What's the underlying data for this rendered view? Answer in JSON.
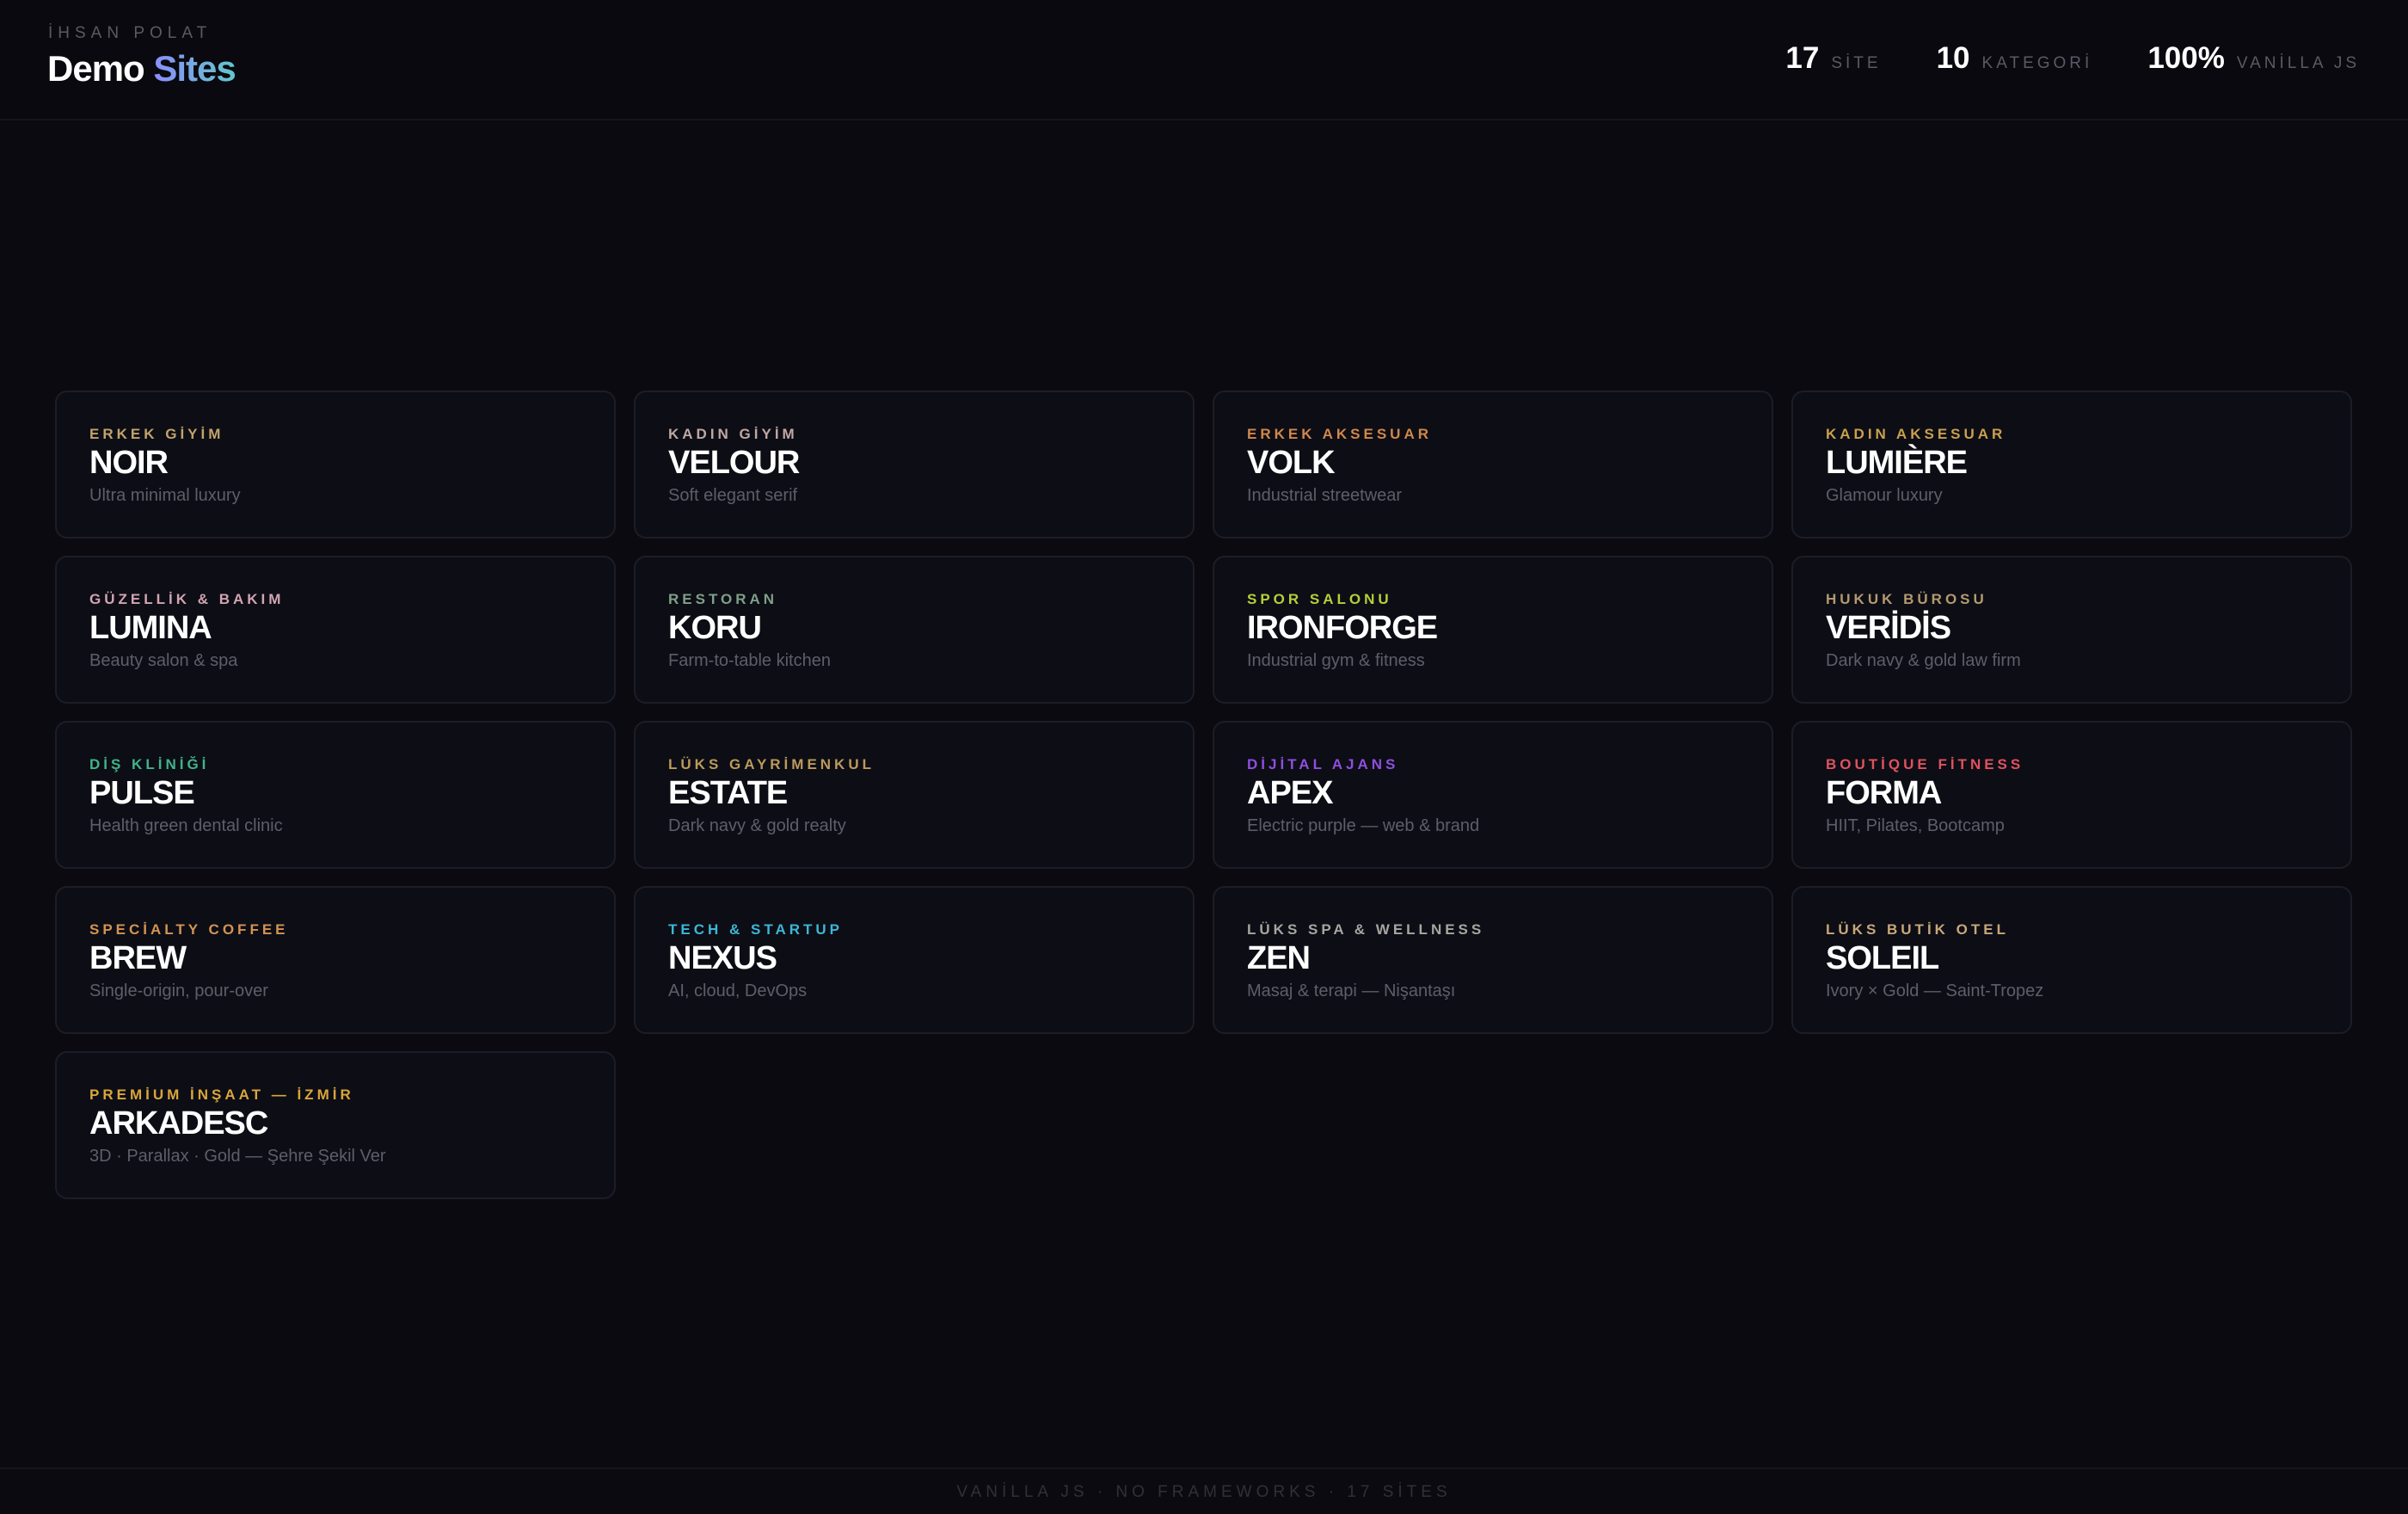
{
  "header": {
    "eyebrow": "İHSAN POLAT",
    "title_part1": "Demo",
    "title_part2": "Sites",
    "title_gradient": [
      "#8b8dfb",
      "#62c7c8"
    ],
    "stats": [
      {
        "value": "17",
        "label": "SİTE"
      },
      {
        "value": "10",
        "label": "KATEGORİ"
      },
      {
        "value": "100%",
        "label": "VANİLLA JS"
      }
    ]
  },
  "sites": [
    {
      "category": "ERKEK GİYİM",
      "name": "NOIR",
      "desc": "Ultra minimal luxury",
      "color": "#c2a36a"
    },
    {
      "category": "KADIN GİYİM",
      "name": "VELOUR",
      "desc": "Soft elegant serif",
      "color": "#bfa8a2"
    },
    {
      "category": "ERKEK AKSESUAR",
      "name": "VOLK",
      "desc": "Industrial streetwear",
      "color": "#d2874a"
    },
    {
      "category": "KADIN AKSESUAR",
      "name": "LUMIÈRE",
      "desc": "Glamour luxury",
      "color": "#c9a04e"
    },
    {
      "category": "GÜZELLİK & BAKIM",
      "name": "LUMINA",
      "desc": "Beauty salon & spa",
      "color": "#d2a4b3"
    },
    {
      "category": "RESTORAN",
      "name": "KORU",
      "desc": "Farm-to-table kitchen",
      "color": "#7fa08a"
    },
    {
      "category": "SPOR SALONU",
      "name": "IRONFORGE",
      "desc": "Industrial gym & fitness",
      "color": "#b7cf3a"
    },
    {
      "category": "HUKUK BÜROSU",
      "name": "VERİDİS",
      "desc": "Dark navy & gold law firm",
      "color": "#b49a6e"
    },
    {
      "category": "DİŞ KLİNİĞİ",
      "name": "PULSE",
      "desc": "Health green dental clinic",
      "color": "#3fb48a"
    },
    {
      "category": "LÜKS GAYRİMENKUL",
      "name": "ESTATE",
      "desc": "Dark navy & gold realty",
      "color": "#bc9a5a"
    },
    {
      "category": "DİJİTAL AJANS",
      "name": "APEX",
      "desc": "Electric purple — web & brand",
      "color": "#8e4fe0"
    },
    {
      "category": "BOUTİQUE FİTNESS",
      "name": "FORMA",
      "desc": "HIIT, Pilates, Bootcamp",
      "color": "#e0525e"
    },
    {
      "category": "SPECİALTY COFFEE",
      "name": "BREW",
      "desc": "Single-origin, pour-over",
      "color": "#d39452"
    },
    {
      "category": "TECH & STARTUP",
      "name": "NEXUS",
      "desc": "AI, cloud, DevOps",
      "color": "#3bb7d6"
    },
    {
      "category": "LÜKS SPA & WELLNESS",
      "name": "ZEN",
      "desc": "Masaj & terapi — Nişantaşı",
      "color": "#a7a6a0"
    },
    {
      "category": "LÜKS BUTİK OTEL",
      "name": "SOLEIL",
      "desc": "Ivory × Gold — Saint-Tropez",
      "color": "#c7a87a"
    },
    {
      "category": "PREMİUM İNŞAAT — İZMİR",
      "name": "ARKADESC",
      "desc": "3D · Parallax · Gold — Şehre Şekil Ver",
      "color": "#d9a63a"
    }
  ],
  "footer": {
    "text": "VANİLLA JS · NO FRAMEWORKS · 17 SİTES"
  }
}
